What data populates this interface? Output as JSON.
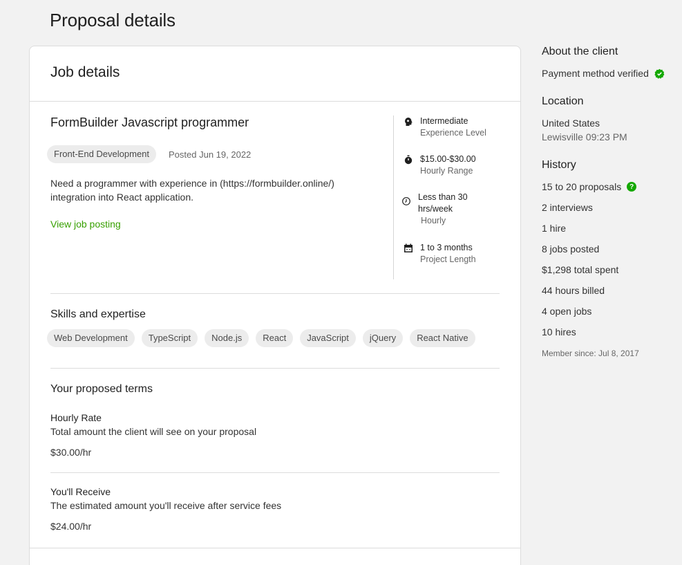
{
  "page": {
    "title": "Proposal details"
  },
  "card": {
    "title": "Job details"
  },
  "job": {
    "title": "FormBuilder Javascript programmer",
    "category": "Front-End Development",
    "posted": "Posted Jun 19, 2022",
    "description": "Need a programmer with experience in (https://formbuilder.online/) integration into React application.",
    "view_link": "View job posting"
  },
  "attributes": [
    {
      "icon": "brain-icon",
      "main": "Intermediate",
      "sub": "Experience Level"
    },
    {
      "icon": "stopwatch-icon",
      "main": "$15.00-$30.00",
      "sub": "Hourly Range"
    },
    {
      "icon": "clock-icon",
      "main": "Less than 30 hrs/week",
      "sub": "Hourly"
    },
    {
      "icon": "calendar-icon",
      "main": "1 to 3 months",
      "sub": "Project Length"
    }
  ],
  "skills": {
    "heading": "Skills and expertise",
    "items": [
      "Web Development",
      "TypeScript",
      "Node.js",
      "React",
      "JavaScript",
      "jQuery",
      "React Native"
    ]
  },
  "terms": {
    "heading": "Your proposed terms",
    "hourly_rate": {
      "label": "Hourly Rate",
      "desc": "Total amount the client will see on your proposal",
      "value": "$30.00/hr"
    },
    "receive": {
      "label": "You'll Receive",
      "desc": "The estimated amount you'll receive after service fees",
      "value": "$24.00/hr"
    }
  },
  "client": {
    "heading": "About the client",
    "payment": "Payment method verified",
    "location_heading": "Location",
    "country": "United States",
    "city_time": "Lewisville 09:23 PM",
    "history_heading": "History",
    "proposals": "15 to 20 proposals",
    "interviews": "2 interviews",
    "hire": "1 hire",
    "jobs_posted": "8 jobs posted",
    "total_spent": "$1,298 total spent",
    "hours_billed": "44 hours billed",
    "open_jobs": "4 open jobs",
    "hires": "10 hires",
    "member_since": "Member since: Jul 8, 2017"
  },
  "colors": {
    "accent_green": "#37a000",
    "verified_green": "#14a800"
  }
}
